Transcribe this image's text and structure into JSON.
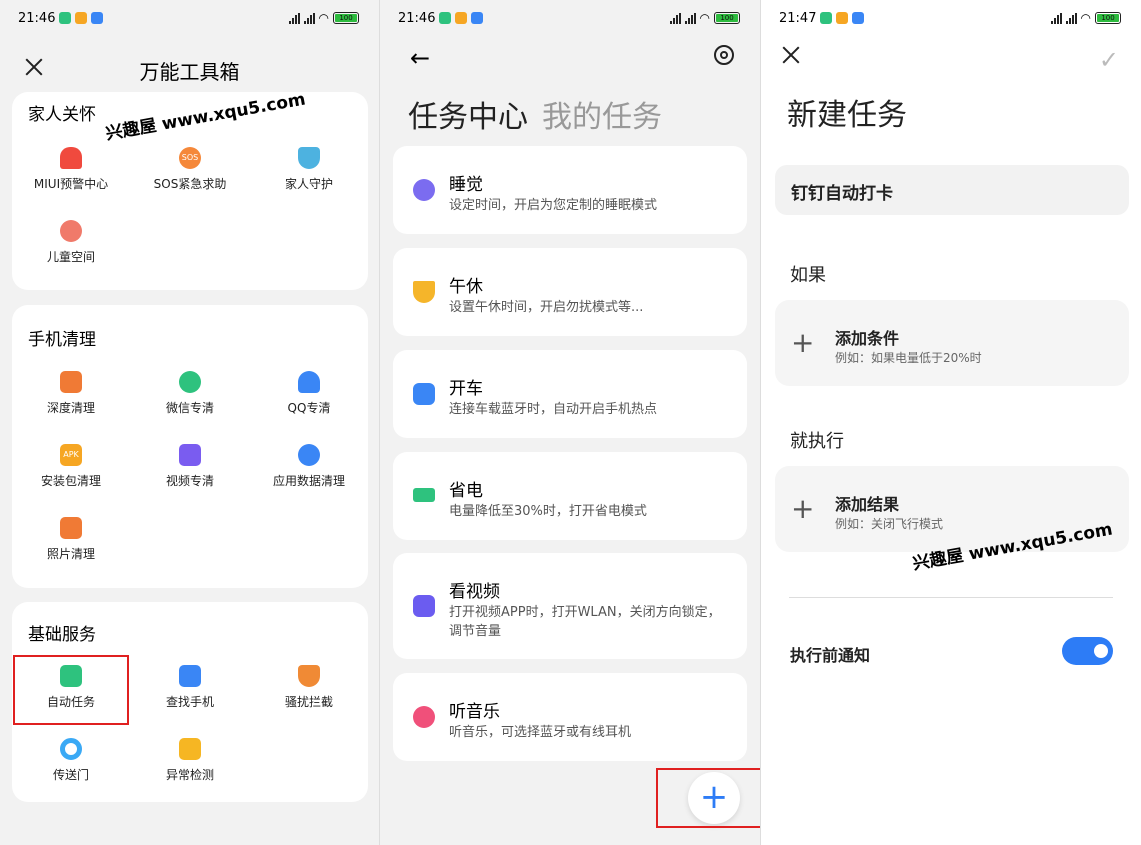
{
  "screen1": {
    "time": "21:46",
    "battery": "100",
    "title": "万能工具箱",
    "watermark": "兴趣屋 www.xqu5.com",
    "sections": [
      {
        "title": "家人关怀",
        "items": [
          "MIUI预警中心",
          "SOS紧急求助",
          "家人守护",
          "儿童空间"
        ]
      },
      {
        "title": "手机清理",
        "items": [
          "深度清理",
          "微信专清",
          "QQ专清",
          "安装包清理",
          "视频专清",
          "应用数据清理",
          "照片清理"
        ]
      },
      {
        "title": "基础服务",
        "items": [
          "自动任务",
          "查找手机",
          "骚扰拦截",
          "传送门",
          "异常检测"
        ]
      }
    ],
    "colors": {
      "alert": "#f04a3e",
      "sos": "#f5883a",
      "guard": "#4db2e0",
      "clean": "#f07a35",
      "wechat": "#2ec27e",
      "qq": "#3a86f5",
      "apk": "#f6a623",
      "video": "#7a5cf0",
      "data": "#3a86f5",
      "photo": "#f07a35",
      "auto": "#2ec27e",
      "find": "#3a86f5",
      "block": "#f08a35",
      "portal": "#3aa9f5",
      "check": "#f6b623"
    }
  },
  "screen2": {
    "time": "21:46",
    "battery": "100",
    "tab_active": "任务中心",
    "tab_inactive": "我的任务",
    "tasks": [
      {
        "name": "睡觉",
        "desc": "设定时间，开启为您定制的睡眠模式",
        "icon": "moon-icon",
        "color": "#7b6cf0"
      },
      {
        "name": "午休",
        "desc": "设置午休时间，开启勿扰模式等...",
        "icon": "coffee-icon",
        "color": "#f5b52a"
      },
      {
        "name": "开车",
        "desc": "连接车载蓝牙时，自动开启手机热点",
        "icon": "car-icon",
        "color": "#3a86f5"
      },
      {
        "name": "省电",
        "desc": "电量降低至30%时，打开省电模式",
        "icon": "battery-icon",
        "color": "#2ec27e"
      },
      {
        "name": "看视频",
        "desc": "打开视频APP时，打开WLAN，关闭方向锁定，调节音量",
        "icon": "video-icon",
        "color": "#6b5cf0"
      },
      {
        "name": "听音乐",
        "desc": "听音乐，可选择蓝牙或有线耳机",
        "icon": "music-icon",
        "color": "#f0507a"
      }
    ],
    "fab_label": "+"
  },
  "screen3": {
    "time": "21:47",
    "battery": "100",
    "title": "新建任务",
    "task_name": "钉钉自动打卡",
    "if_label": "如果",
    "add_condition": "添加条件",
    "condition_example": "例如：如果电量低于20%时",
    "then_label": "就执行",
    "add_result": "添加结果",
    "result_example": "例如：关闭飞行模式",
    "notify_label": "执行前通知",
    "notify_on": true,
    "watermark": "兴趣屋 www.xqu5.com"
  }
}
